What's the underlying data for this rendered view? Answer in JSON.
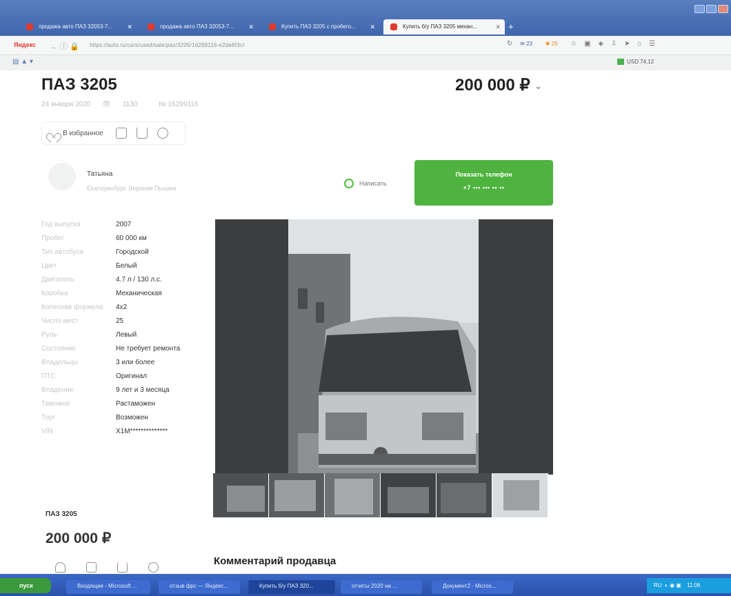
{
  "browser": {
    "tabs": [
      {
        "label": "продажа авто ПАЗ 32053-7..."
      },
      {
        "label": "продажа авто ПАЗ 32053-7..."
      },
      {
        "label": "Купить ПАЗ 3205 с пробего..."
      },
      {
        "label": "Купить б/у ПАЗ 3205 механ...",
        "active": true
      }
    ],
    "brand": "Яндекс",
    "url": "https://auto.ru/cars/used/sale/paz/3205/16299116-e2de6f3c/",
    "counter_badge": "23",
    "bell_count": "29",
    "usd_rate": "USD 74,12"
  },
  "listing": {
    "title": "ПАЗ 3205",
    "price": "200 000 ₽",
    "date": "24 января 2020",
    "views": "1130",
    "number": "№ 16299116",
    "favorite_label": "В избранное",
    "seller_name": "Татьяна",
    "seller_location": "Екатеринбург, Верхняя Пышма",
    "write_label": "Написать",
    "phone_title": "Показать телефон",
    "phone_masked": "+7 ••• ••• •• ••",
    "specs": [
      {
        "k": "Год выпуска",
        "v": "2007"
      },
      {
        "k": "Пробег",
        "v": "60 000 км"
      },
      {
        "k": "Тип автобуса",
        "v": "Городской"
      },
      {
        "k": "Цвет",
        "v": "Белый"
      },
      {
        "k": "Двигатель",
        "v": "4.7 л / 130 л.с."
      },
      {
        "k": "Коробка",
        "v": "Механическая"
      },
      {
        "k": "Колесная формула",
        "v": "4x2"
      },
      {
        "k": "Число мест",
        "v": "25"
      },
      {
        "k": "Руль",
        "v": "Левый"
      },
      {
        "k": "Состояние",
        "v": "Не требует ремонта"
      },
      {
        "k": "Владельцы",
        "v": "3 или более"
      },
      {
        "k": "ПТС",
        "v": "Оригинал"
      },
      {
        "k": "Владение",
        "v": "9 лет и 3 месяца"
      },
      {
        "k": "Таможня",
        "v": "Растаможен"
      },
      {
        "k": "Торг",
        "v": "Возможен"
      },
      {
        "k": "VIN",
        "v": "X1M**************"
      }
    ],
    "bottom_title": "ПАЗ 3205",
    "bottom_price": "200 000 ₽",
    "comment_heading": "Комментарий продавца",
    "accent_green": "#4fb43f"
  },
  "taskbar": {
    "start": "пуск",
    "items": [
      {
        "label": "Входящие - Microsoft ..."
      },
      {
        "label": "отзыв фрс — Яндекс..."
      },
      {
        "label": "Купить б/у ПАЗ 320...",
        "active": true
      },
      {
        "label": "отчеты 2020 на ..."
      },
      {
        "label": "Документ2 - Micros..."
      }
    ],
    "tray": "RU",
    "clock": "11:06"
  }
}
